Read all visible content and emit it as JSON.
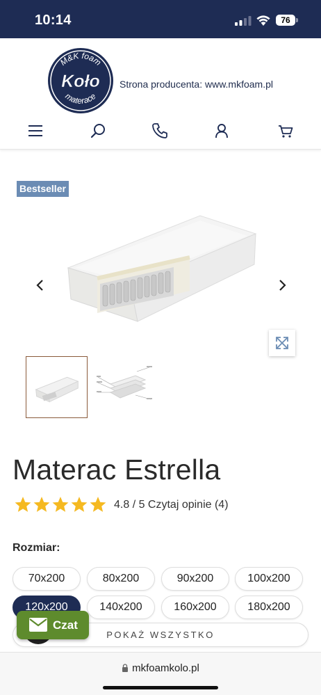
{
  "status_bar": {
    "time": "10:14",
    "battery": "76"
  },
  "header": {
    "logo": {
      "top_text": "M&K foam",
      "middle_text": "Koło",
      "bottom_text": "materace"
    },
    "producer_text": "Strona producenta: www.mkfoam.pl",
    "nav": [
      "menu-icon",
      "search-icon",
      "phone-icon",
      "user-icon",
      "cart-icon"
    ]
  },
  "gallery": {
    "badge": "Bestseller",
    "thumbnail_count": 2,
    "active_thumbnail": 1
  },
  "product": {
    "title": "Materac Estrella",
    "rating": 4.8,
    "stars_filled": 5,
    "rating_text": "4.8 / 5 Czytaj opinie (4)"
  },
  "sizes": {
    "label": "Rozmiar:",
    "options": [
      "70x200",
      "80x200",
      "90x200",
      "100x200",
      "120x200",
      "140x200",
      "160x200",
      "180x200"
    ],
    "selected": "120x200",
    "show_all": "POKAŻ WSZYSTKO"
  },
  "chat": {
    "label": "Czat"
  },
  "browser": {
    "url": "mkfoamkolo.pl"
  },
  "colors": {
    "navy": "#1e2c54",
    "badge": "#6b8cb4",
    "chat": "#5e8b2d",
    "star": "#f5b921"
  }
}
